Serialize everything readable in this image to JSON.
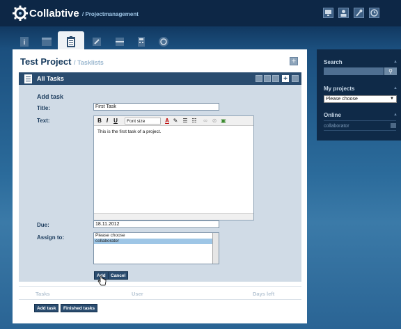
{
  "app": {
    "name": "Collabtive",
    "subtitle": "/ Projectmanagement"
  },
  "top_icons": [
    "desktop-icon",
    "user-icon",
    "wrench-icon",
    "clock-icon"
  ],
  "tabs": [
    {
      "name": "info-icon",
      "active": false
    },
    {
      "name": "calendar-icon",
      "active": false
    },
    {
      "name": "tasklist-icon",
      "active": true
    },
    {
      "name": "edit-icon",
      "active": false
    },
    {
      "name": "files-icon",
      "active": false
    },
    {
      "name": "calculator-icon",
      "active": false
    },
    {
      "name": "timer-icon",
      "active": false
    }
  ],
  "page": {
    "title": "Test Project",
    "subtitle": "/ Tasklists"
  },
  "block": {
    "title": "All Tasks"
  },
  "form": {
    "heading": "Add task",
    "title_label": "Title:",
    "title_value": "First Task",
    "text_label": "Text:",
    "text_value": "This is the first task of a project.",
    "due_label": "Due:",
    "due_value": "18.11.2012",
    "assign_label": "Assign to:",
    "assign_options": [
      "Please choose",
      "collaborator"
    ],
    "assign_selected": "collaborator",
    "add_button": "Add",
    "cancel_button": "Cancel"
  },
  "editor_toolbar": {
    "bold": "B",
    "italic": "I",
    "underline": "U",
    "font_size": "Font size"
  },
  "table": {
    "col_tasks": "Tasks",
    "col_user": "User",
    "col_days": "Days left"
  },
  "footer_buttons": {
    "add_task": "Add task",
    "finished_tasks": "Finished tasks"
  },
  "sidebar": {
    "search_title": "Search",
    "projects_title": "My projects",
    "projects_select": "Please choose",
    "online_title": "Online",
    "online_user": "collaborator"
  }
}
